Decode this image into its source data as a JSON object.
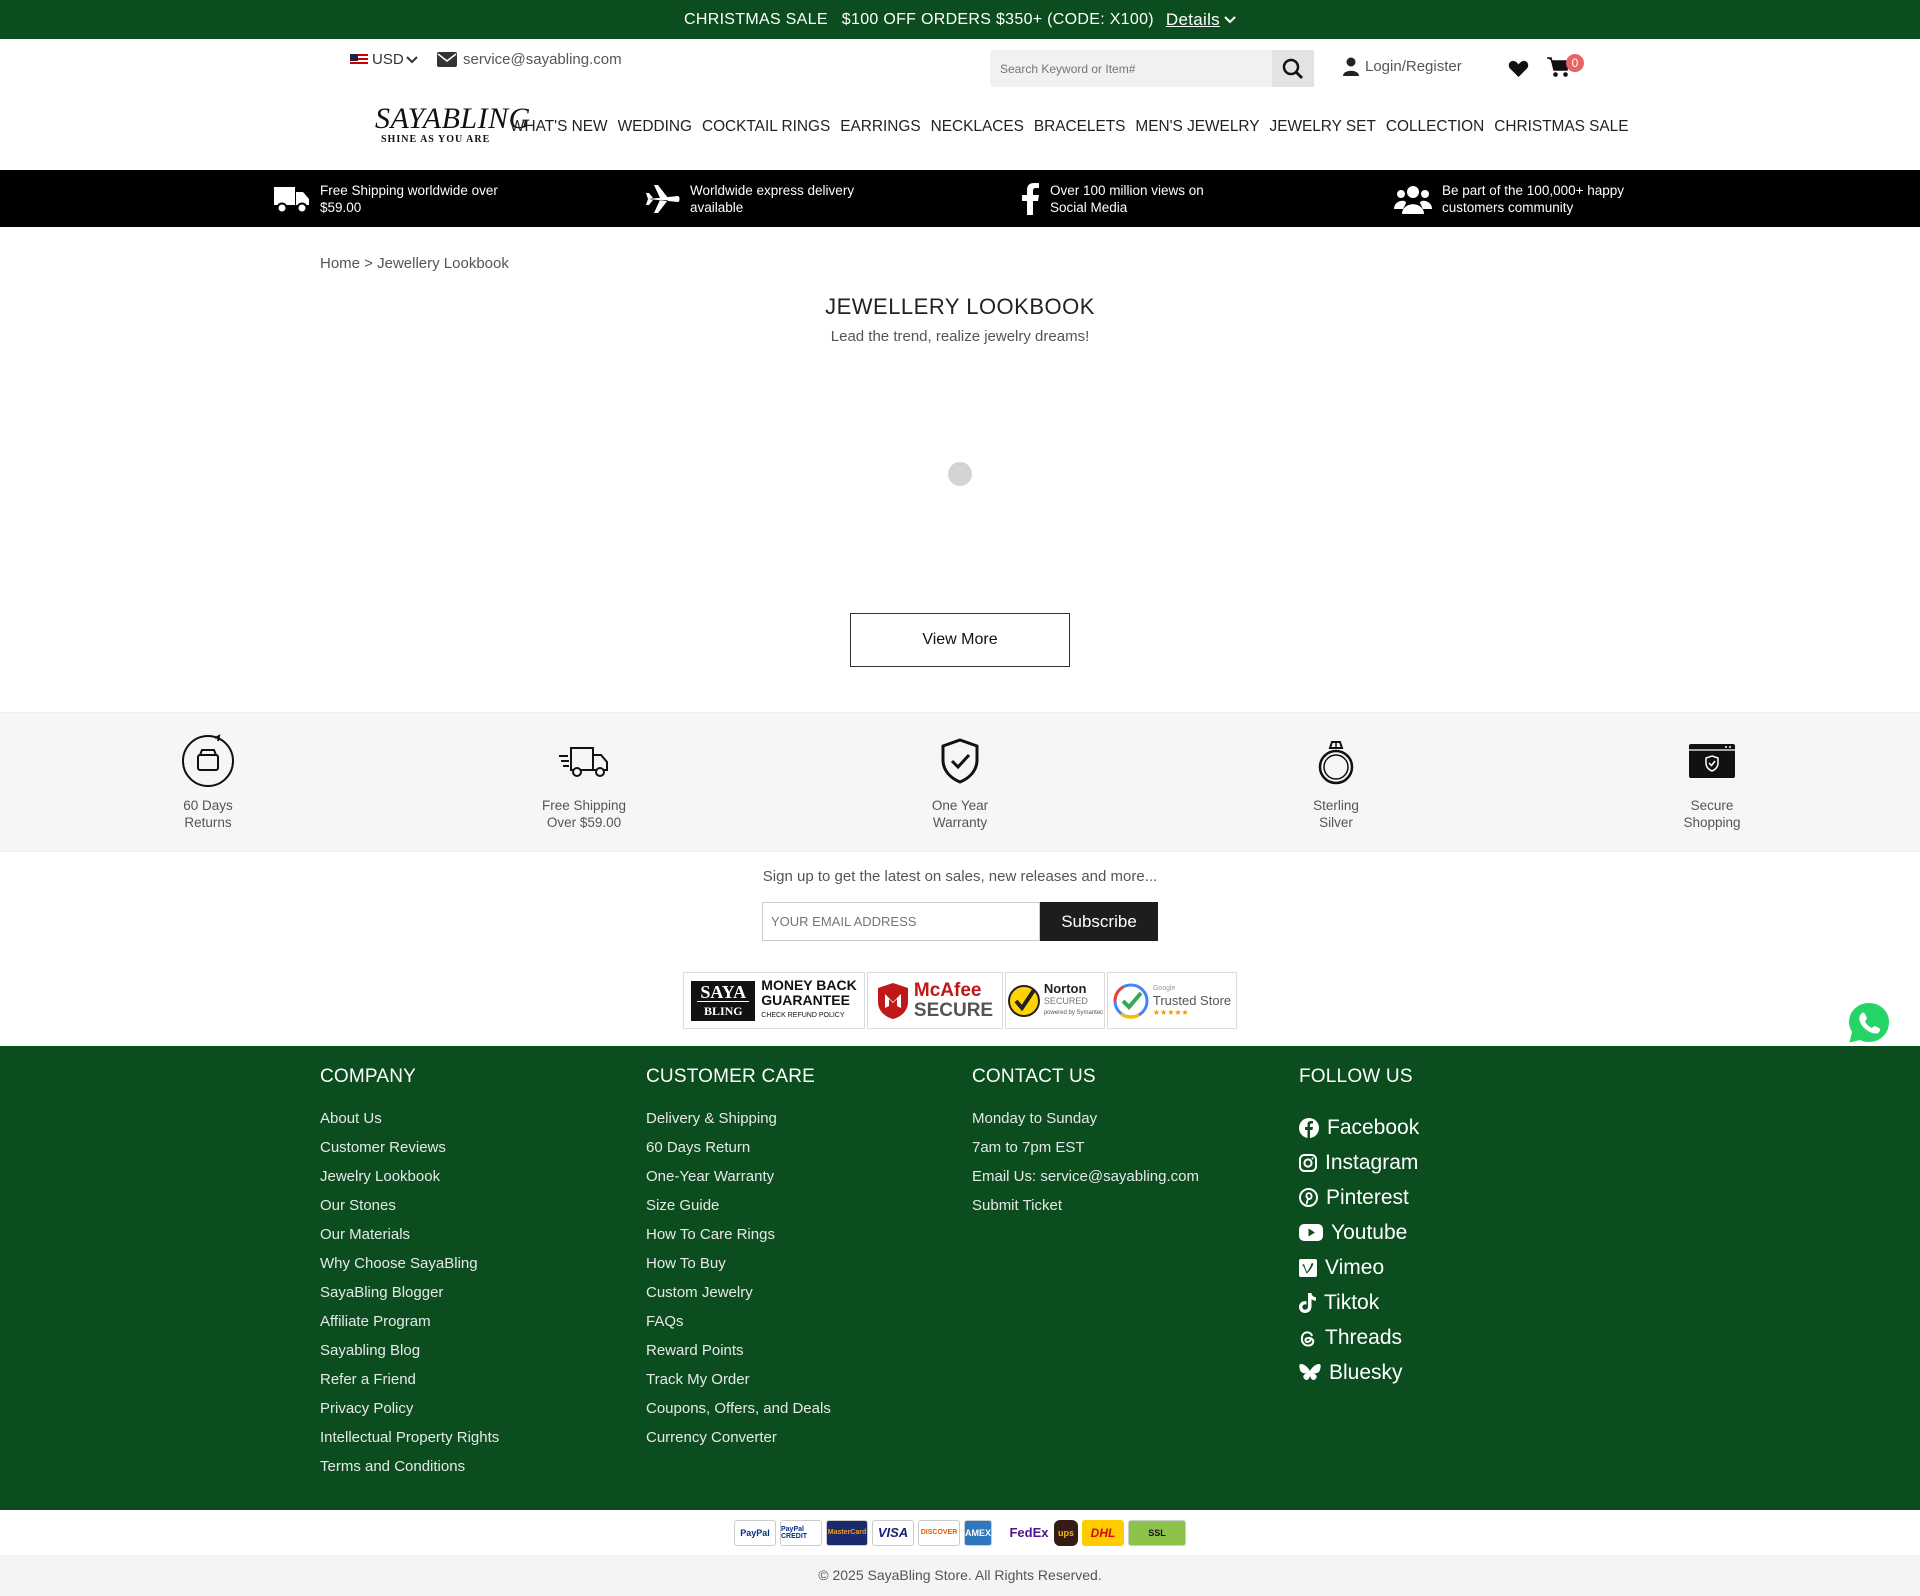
{
  "announcement": {
    "label": "CHRISTMAS SALE",
    "promo": "$100 OFF ORDERS $350+ (CODE: X100)",
    "details": "Details"
  },
  "header": {
    "currency": "USD",
    "email": "service@sayabling.com",
    "search_placeholder": "Search Keyword or Item#",
    "login": "Login/Register",
    "cart_count": "0",
    "logo_main": "SAYABLING",
    "logo_tagline": "SHINE AS YOU ARE"
  },
  "nav": [
    "WHAT'S NEW",
    "WEDDING",
    "COCKTAIL RINGS",
    "EARRINGS",
    "NECKLACES",
    "BRACELETS",
    "MEN'S JEWELRY",
    "JEWELRY SET",
    "COLLECTION",
    "CHRISTMAS SALE"
  ],
  "features": [
    {
      "text": "Free Shipping worldwide over $59.00",
      "icon": "truck-icon"
    },
    {
      "text": "Worldwide express delivery available",
      "icon": "plane-icon"
    },
    {
      "text": "Over 100 million views on Social Media",
      "icon": "facebook-icon"
    },
    {
      "text": "Be part of the 100,000+ happy customers community",
      "icon": "users-icon"
    }
  ],
  "breadcrumb": "Home > Jewellery Lookbook",
  "page": {
    "title": "JEWELLERY LOOKBOOK",
    "subtitle": "Lead the trend, realize jewelry dreams!",
    "view_more": "View More"
  },
  "services": [
    {
      "line1": "60 Days",
      "line2": "Returns",
      "icon": "returns-icon"
    },
    {
      "line1": "Free Shipping",
      "line2": "Over $59.00",
      "icon": "shipping-truck-icon"
    },
    {
      "line1": "One Year",
      "line2": "Warranty",
      "icon": "shield-check-icon"
    },
    {
      "line1": "Sterling",
      "line2": "Silver",
      "icon": "ring-icon"
    },
    {
      "line1": "Secure",
      "line2": "Shopping",
      "icon": "secure-card-icon"
    }
  ],
  "newsletter": {
    "text": "Sign up to get the latest on sales, new releases and more...",
    "placeholder": "YOUR EMAIL ADDRESS",
    "button": "Subscribe"
  },
  "trust_badges": {
    "saya_line1": "SAYA",
    "saya_line2": "BLING",
    "money_back_1": "MONEY BACK",
    "money_back_2": "GUARANTEE",
    "money_back_3": "CHECK REFUND POLICY",
    "mcafee_1": "McAfee",
    "mcafee_2": "SECURE",
    "norton_1": "Norton",
    "norton_2": "SECURED",
    "norton_3": "powered by Symantec",
    "google_1": "Google",
    "google_2": "Trusted Store"
  },
  "footer": {
    "company": {
      "title": "COMPANY",
      "links": [
        "About Us",
        "Customer Reviews",
        "Jewelry Lookbook",
        "Our Stones",
        "Our Materials",
        "Why Choose SayaBling",
        "SayaBling Blogger",
        "Affiliate Program",
        "Sayabling Blog",
        "Refer a Friend",
        "Privacy Policy",
        "Intellectual Property Rights",
        "Terms and Conditions"
      ]
    },
    "care": {
      "title": "CUSTOMER CARE",
      "links": [
        "Delivery & Shipping",
        "60 Days Return",
        "One-Year Warranty",
        "Size Guide",
        "How To Care Rings",
        "How To Buy",
        "Custom Jewelry",
        "FAQs",
        "Reward Points",
        "Track My Order",
        "Coupons, Offers, and Deals",
        "Currency Converter"
      ]
    },
    "contact": {
      "title": "CONTACT US",
      "links": [
        "Monday to Sunday",
        "7am to 7pm EST",
        "Email Us: service@sayabling.com",
        "Submit Ticket"
      ]
    },
    "follow": {
      "title": "FOLLOW US",
      "links": [
        "Facebook",
        "Instagram",
        "Pinterest",
        "Youtube",
        "Vimeo",
        "Tiktok",
        "Threads",
        "Bluesky"
      ]
    }
  },
  "payments": [
    "PayPal",
    "PayPal CREDIT",
    "MasterCard",
    "VISA",
    "DISCOVER",
    "AMEX",
    "FedEx",
    "ups",
    "DHL",
    "SSL"
  ],
  "copyright": "© 2025 SayaBling Store. All Rights Reserved.",
  "colors": {
    "brand_green": "#0b4d1f",
    "cart_badge": "#e86464"
  }
}
